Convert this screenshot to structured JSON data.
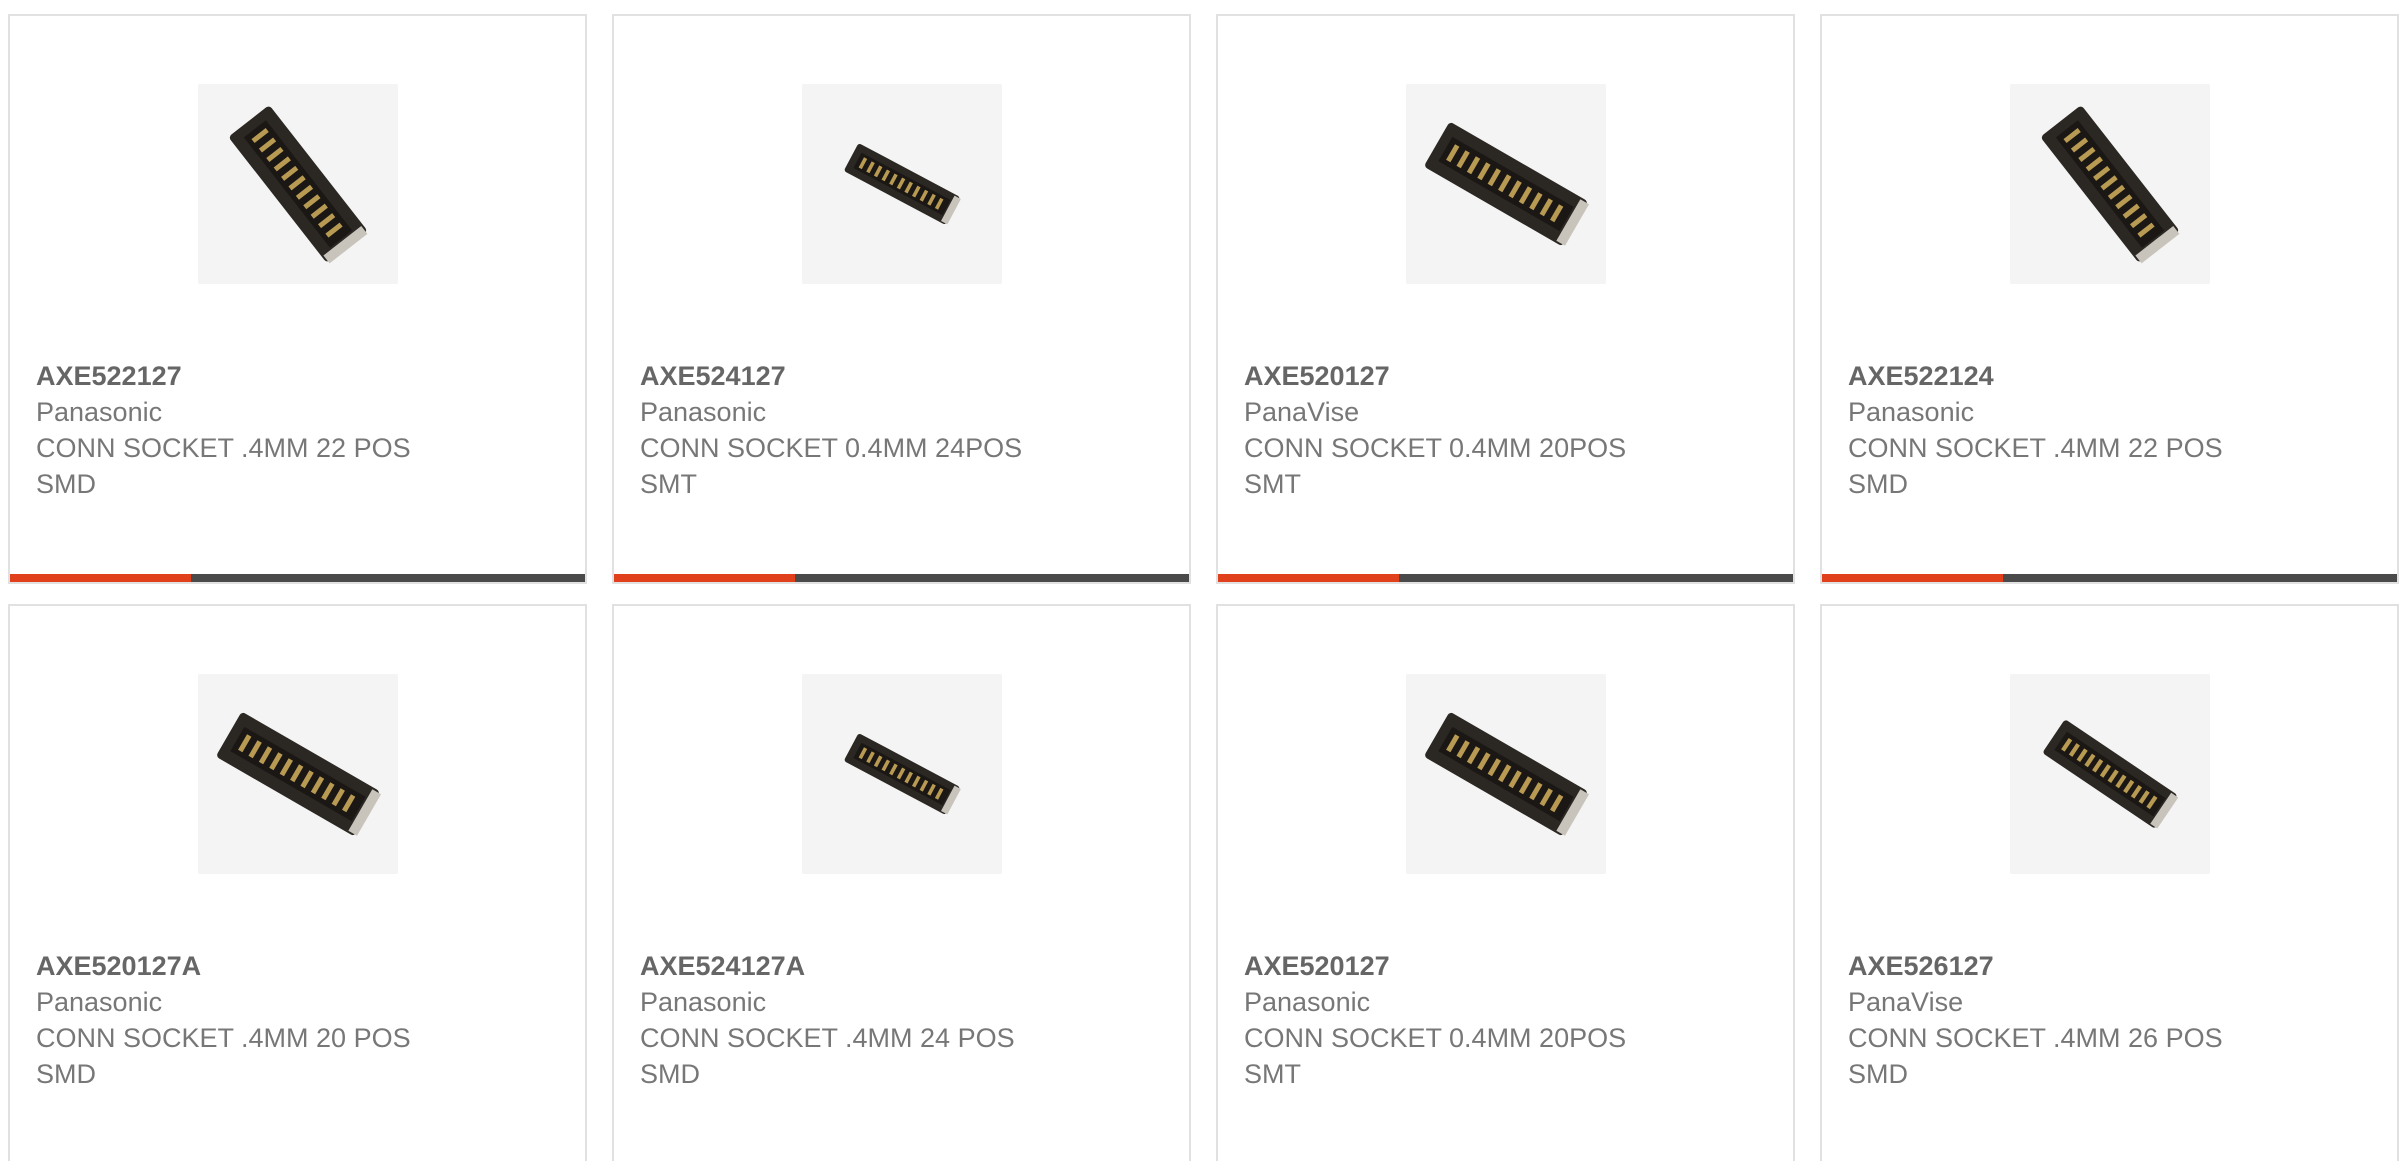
{
  "accent_color": "#e0401c",
  "bar_color": "#4a4a4a",
  "products": [
    {
      "part": "AXE522127",
      "mfr": "Panasonic",
      "desc": "CONN SOCKET .4MM 22 POS\nSMD",
      "icon": "connector-image"
    },
    {
      "part": "AXE524127",
      "mfr": "Panasonic",
      "desc": "CONN SOCKET 0.4MM 24POS\nSMT",
      "icon": "connector-image"
    },
    {
      "part": "AXE520127",
      "mfr": "PanaVise",
      "desc": "CONN SOCKET 0.4MM 20POS\nSMT",
      "icon": "connector-image"
    },
    {
      "part": "AXE522124",
      "mfr": "Panasonic",
      "desc": "CONN SOCKET .4MM 22 POS\nSMD",
      "icon": "connector-image"
    },
    {
      "part": "AXE520127A",
      "mfr": "Panasonic",
      "desc": "CONN SOCKET .4MM 20 POS\nSMD",
      "icon": "connector-image"
    },
    {
      "part": "AXE524127A",
      "mfr": "Panasonic",
      "desc": "CONN SOCKET .4MM 24 POS\nSMD",
      "icon": "connector-image"
    },
    {
      "part": "AXE520127",
      "mfr": "Panasonic",
      "desc": "CONN SOCKET 0.4MM 20POS\nSMT",
      "icon": "connector-image"
    },
    {
      "part": "AXE526127",
      "mfr": "PanaVise",
      "desc": "CONN SOCKET .4MM 26 POS\nSMD",
      "icon": "connector-image"
    }
  ]
}
